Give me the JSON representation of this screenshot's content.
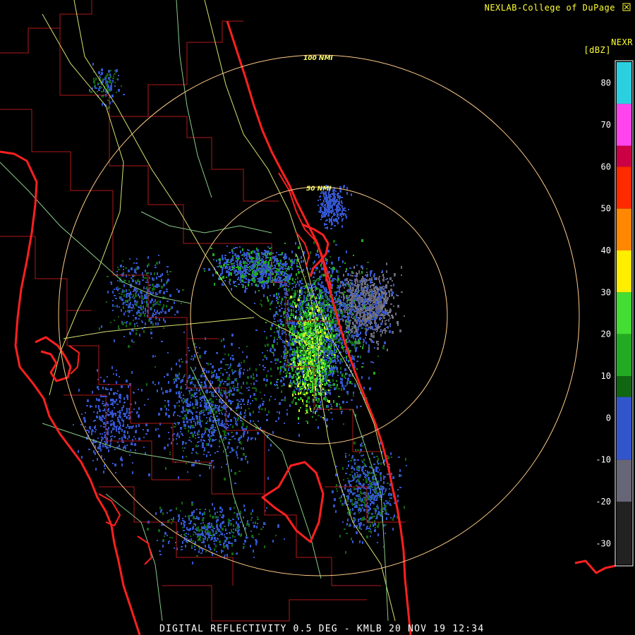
{
  "header": {
    "credit": "NEXLAB-College of DuPage",
    "logo_icon": "college-logo-icon",
    "product": "NEXR",
    "unit": "[dBZ]"
  },
  "footer": {
    "caption": "DIGITAL REFLECTIVITY 0.5 DEG - KMLB 20 NOV 19 12:34"
  },
  "range_rings": [
    {
      "label": "50 NMI",
      "nmi": 50
    },
    {
      "label": "100 NMI",
      "nmi": 100
    }
  ],
  "color_scale": {
    "ticks": [
      "80",
      "70",
      "60",
      "50",
      "40",
      "30",
      "20",
      "10",
      "0",
      "-10",
      "-20",
      "-30"
    ],
    "tick_values": [
      80,
      70,
      60,
      50,
      40,
      30,
      20,
      10,
      0,
      -10,
      -20,
      -30
    ],
    "range": [
      -35,
      85
    ],
    "bands": [
      {
        "from": 75,
        "to": 85,
        "color": "#2ad0e0"
      },
      {
        "from": 65,
        "to": 75,
        "color": "#ff44ee"
      },
      {
        "from": 60,
        "to": 65,
        "color": "#cc0044"
      },
      {
        "from": 50,
        "to": 60,
        "color": "#ff2a00"
      },
      {
        "from": 40,
        "to": 50,
        "color": "#ff8800"
      },
      {
        "from": 30,
        "to": 40,
        "color": "#ffee00"
      },
      {
        "from": 20,
        "to": 30,
        "color": "#44dd33"
      },
      {
        "from": 10,
        "to": 20,
        "color": "#22aa22"
      },
      {
        "from": 5,
        "to": 10,
        "color": "#116611"
      },
      {
        "from": -10,
        "to": 5,
        "color": "#3355cc"
      },
      {
        "from": -20,
        "to": -10,
        "color": "#666677"
      },
      {
        "from": -35,
        "to": -20,
        "color": "#222222"
      }
    ]
  },
  "colors": {
    "coast": "#ff2020",
    "county": "#b01818",
    "road": "#d8e070",
    "road_minor": "#88cc88",
    "ring": "#ffcc88",
    "text": "#ffff33"
  }
}
